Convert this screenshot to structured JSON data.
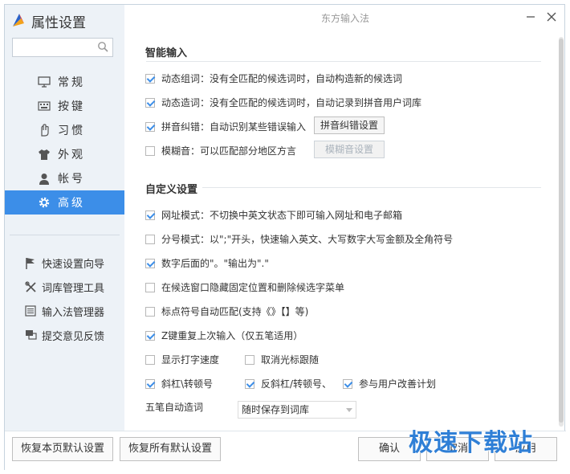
{
  "app": {
    "title": "属性设置",
    "window_title": "东方输入法"
  },
  "search": {
    "placeholder": ""
  },
  "nav": [
    {
      "label": "常规",
      "icon": "monitor-icon"
    },
    {
      "label": "按键",
      "icon": "keyboard-icon"
    },
    {
      "label": "习惯",
      "icon": "hand-icon"
    },
    {
      "label": "外观",
      "icon": "shirt-icon"
    },
    {
      "label": "帐号",
      "icon": "user-icon"
    },
    {
      "label": "高级",
      "icon": "gear-icon",
      "active": true
    }
  ],
  "tools": [
    {
      "label": "快速设置向导",
      "icon": "flag-icon"
    },
    {
      "label": "词库管理工具",
      "icon": "tools-icon"
    },
    {
      "label": "输入法管理器",
      "icon": "list-icon"
    },
    {
      "label": "提交意见反馈",
      "icon": "feedback-icon"
    }
  ],
  "smart": {
    "title": "智能输入",
    "options": [
      {
        "label": "动态组词：没有全匹配的候选词时，自动构造新的候选词",
        "checked": true
      },
      {
        "label": "动态造词：没有全匹配的候选词时，自动记录到拼音用户词库",
        "checked": true
      },
      {
        "label": "拼音纠错：自动识别某些错误输入",
        "checked": true,
        "button": "拼音纠错设置"
      },
      {
        "label": "模糊音：可以匹配部分地区方言",
        "checked": false,
        "button": "模糊音设置"
      }
    ]
  },
  "custom": {
    "title": "自定义设置",
    "options": [
      {
        "label": "网址模式：不切换中英文状态下即可输入网址和电子邮箱",
        "checked": true
      },
      {
        "label": "分号模式：以\";\"开头，快速输入英文、大写数字大写金额及全角符号",
        "checked": false
      },
      {
        "label": "数字后面的\"。\"输出为\".\"",
        "checked": true
      },
      {
        "label": "在候选窗口隐藏固定位置和删除候选字菜单",
        "checked": false
      },
      {
        "label": "标点符号自动匹配(支持《》【】等)",
        "checked": false
      },
      {
        "label": "Z键重复上次输入（仅五笔适用）",
        "checked": true
      },
      {
        "label": "显示打字速度",
        "checked": false
      },
      {
        "label": "取消光标跟随",
        "checked": false
      },
      {
        "label": "斜杠\\转顿号",
        "checked": true
      },
      {
        "label": "反斜杠/转顿号、",
        "checked": true
      },
      {
        "label": "参与用户改善计划",
        "checked": true
      }
    ],
    "wubi_label": "五笔自动造词",
    "wubi_value": "随时保存到词库"
  },
  "footer": {
    "restore_page": "恢复本页默认设置",
    "restore_all": "恢复所有默认设置",
    "ok": "确认",
    "cancel": "取消",
    "apply": "应用"
  },
  "watermark": "极速下载站"
}
